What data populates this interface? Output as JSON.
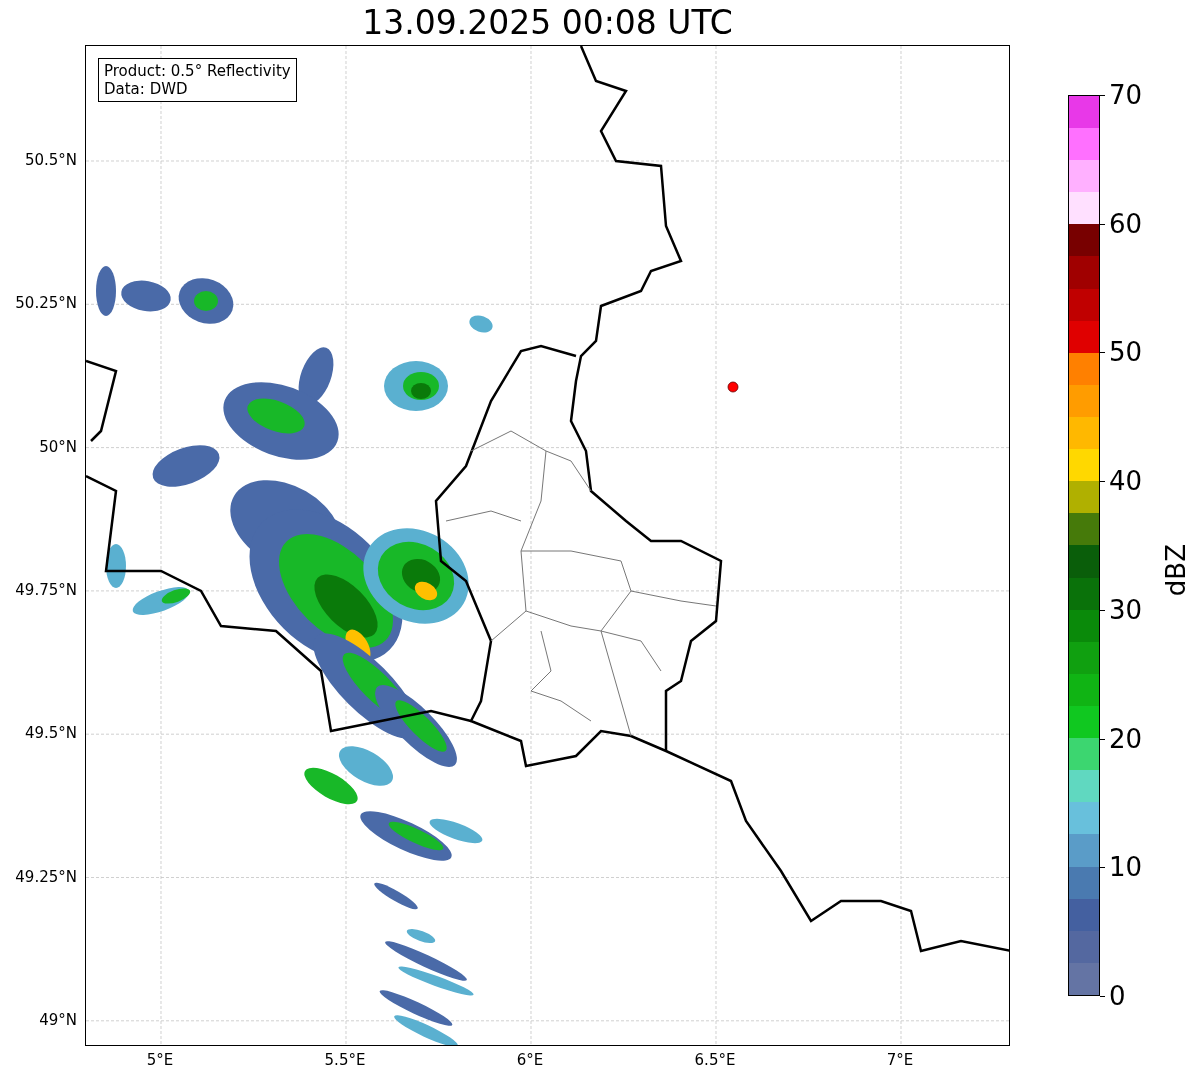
{
  "title": "13.09.2025 00:08 UTC",
  "legend": [
    "Product: 0.5° Reflectivity",
    "Data: DWD"
  ],
  "map": {
    "xticks": [
      "5°E",
      "5.5°E",
      "6°E",
      "6.5°E",
      "7°E"
    ],
    "yticks": [
      "50.5°N",
      "50.25°N",
      "50°N",
      "49.75°N",
      "49.5°N",
      "49.25°N",
      "49°N"
    ]
  },
  "colorbar": {
    "label": "dBZ",
    "ticks": [
      "70",
      "60",
      "50",
      "40",
      "30",
      "20",
      "10",
      "0"
    ],
    "segments": [
      {
        "color": "#6474a4"
      },
      {
        "color": "#5468a0"
      },
      {
        "color": "#4460a0"
      },
      {
        "color": "#4a7ab0"
      },
      {
        "color": "#5a9cc8"
      },
      {
        "color": "#68c0dc"
      },
      {
        "color": "#60d8c0"
      },
      {
        "color": "#3cd670"
      },
      {
        "color": "#10c820"
      },
      {
        "color": "#10b414"
      },
      {
        "color": "#10a010"
      },
      {
        "color": "#0a8a0a"
      },
      {
        "color": "#0a720a"
      },
      {
        "color": "#0a5e0a"
      },
      {
        "color": "#467a0a"
      },
      {
        "color": "#b0b000"
      },
      {
        "color": "#ffd800"
      },
      {
        "color": "#ffb800"
      },
      {
        "color": "#ff9c00"
      },
      {
        "color": "#ff8000"
      },
      {
        "color": "#e00000"
      },
      {
        "color": "#c00000"
      },
      {
        "color": "#a00000"
      },
      {
        "color": "#780000"
      },
      {
        "color": "#ffe0ff"
      },
      {
        "color": "#ffb0ff"
      },
      {
        "color": "#ff70ff"
      },
      {
        "color": "#e838e8"
      }
    ]
  }
}
